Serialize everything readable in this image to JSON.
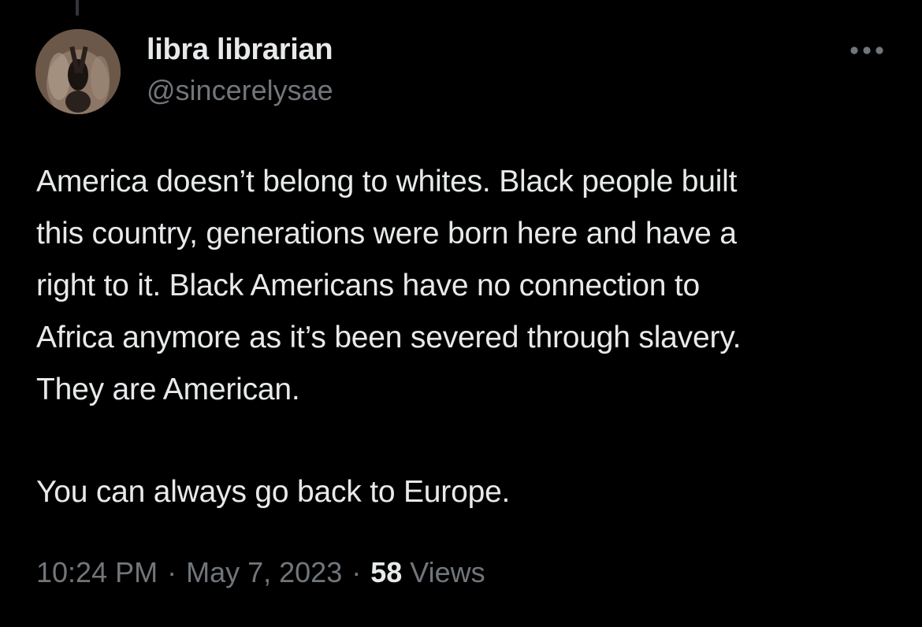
{
  "tweet": {
    "author": {
      "display_name": "libra librarian",
      "handle": "@sincerelysae"
    },
    "more_icon": "more-horizontal-icon",
    "text_lines": [
      "America doesn’t belong to whites. Black people built",
      "this country, generations were born here and have a",
      "right to it. Black Americans have no connection to",
      "Africa anymore as it’s been severed through slavery.",
      "They are American."
    ],
    "text_paragraph_2": "You can always go back to Europe.",
    "time": "10:24 PM",
    "date": "May 7, 2023",
    "separator": "·",
    "views_count": "58",
    "views_label": "Views"
  },
  "colors": {
    "background": "#000000",
    "primary_text": "#e7e9ea",
    "secondary_text": "#71767b",
    "thread_line": "#333639"
  }
}
